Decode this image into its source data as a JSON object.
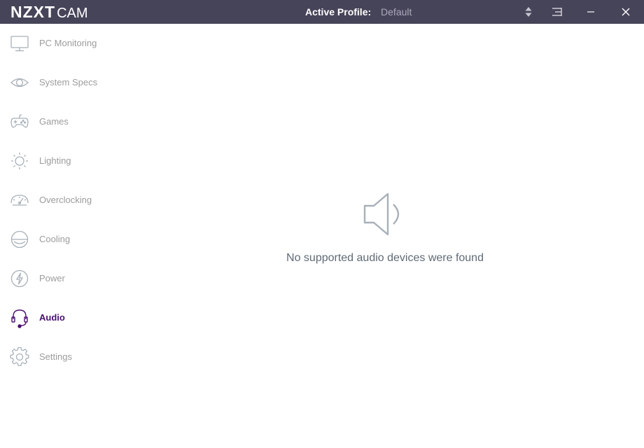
{
  "app": {
    "brand_main": "NZXT",
    "brand_sub": "CAM"
  },
  "header": {
    "profile_label": "Active Profile:",
    "profile_value": "Default",
    "buttons": [
      {
        "name": "profile-switch",
        "icon": "sort-arrows-icon"
      },
      {
        "name": "menu",
        "icon": "menu-icon"
      },
      {
        "name": "minimize",
        "icon": "minimize-icon"
      },
      {
        "name": "close",
        "icon": "close-icon"
      }
    ]
  },
  "sidebar": {
    "items": [
      {
        "label": "PC Monitoring",
        "icon": "monitor-icon",
        "active": false
      },
      {
        "label": "System Specs",
        "icon": "eye-icon",
        "active": false
      },
      {
        "label": "Games",
        "icon": "gamepad-icon",
        "active": false
      },
      {
        "label": "Lighting",
        "icon": "sun-icon",
        "active": false
      },
      {
        "label": "Overclocking",
        "icon": "speedometer-icon",
        "active": false
      },
      {
        "label": "Cooling",
        "icon": "cooling-icon",
        "active": false
      },
      {
        "label": "Power",
        "icon": "lightning-icon",
        "active": false
      },
      {
        "label": "Audio",
        "icon": "headset-icon",
        "active": true
      },
      {
        "label": "Settings",
        "icon": "gear-icon",
        "active": false
      }
    ]
  },
  "main": {
    "empty_icon": "speaker-icon",
    "empty_message": "No supported audio devices were found"
  },
  "colors": {
    "titlebar": "#464459",
    "active_accent": "#4b0f6e",
    "inactive_text": "#9c9c9c",
    "icon_gray": "#a8b0b8"
  }
}
